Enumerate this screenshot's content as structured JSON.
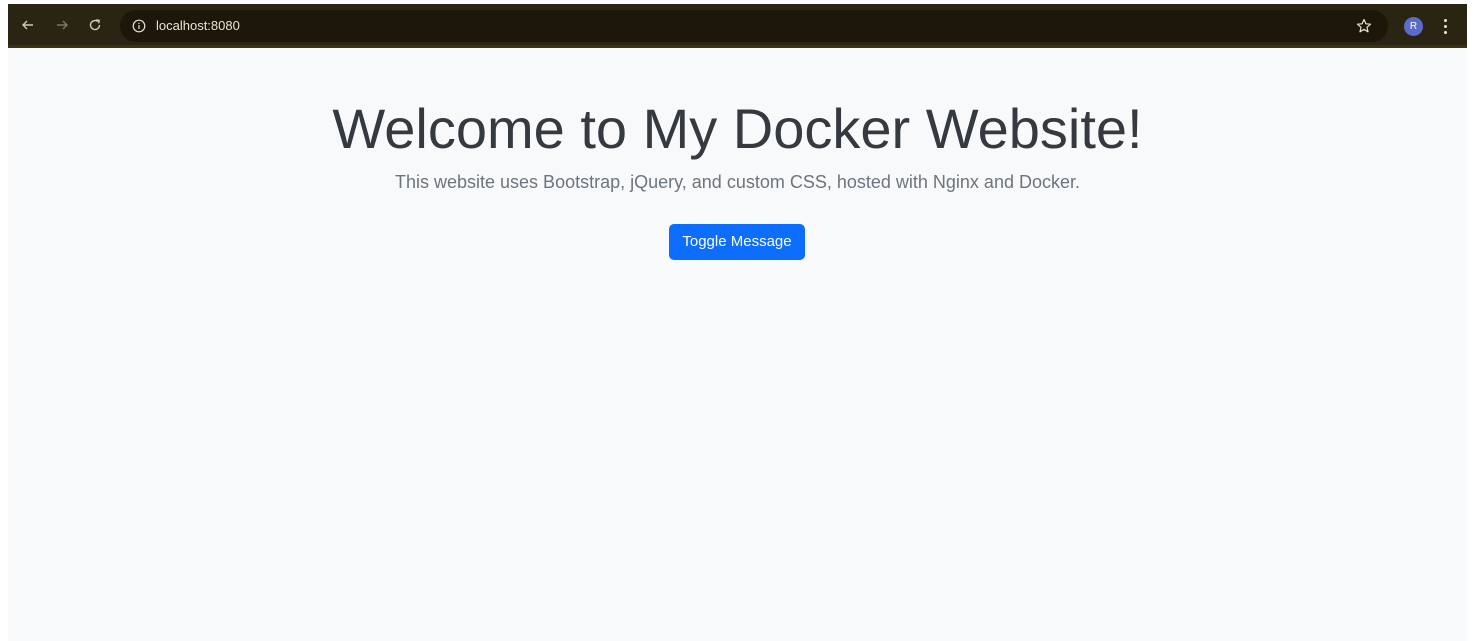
{
  "browser": {
    "url": "localhost:8080",
    "avatar_initial": "R",
    "icons": {
      "back": "arrow-left-icon",
      "forward": "arrow-right-icon",
      "reload": "reload-icon",
      "site_info": "info-circle-icon",
      "bookmark": "star-icon",
      "menu": "kebab-menu-icon"
    },
    "colors": {
      "toolbar": "#2a2412",
      "omnibox": "#1c1709",
      "avatar": "#5b6bc8"
    }
  },
  "page": {
    "title": "Welcome to My Docker Website!",
    "lead": "This website uses Bootstrap, jQuery, and custom CSS, hosted with Nginx and Docker.",
    "toggle_button_label": "Toggle Message",
    "colors": {
      "background": "#f8f9fa",
      "title": "#343a40",
      "lead": "#6c757d",
      "button": "#0d6efd"
    }
  }
}
